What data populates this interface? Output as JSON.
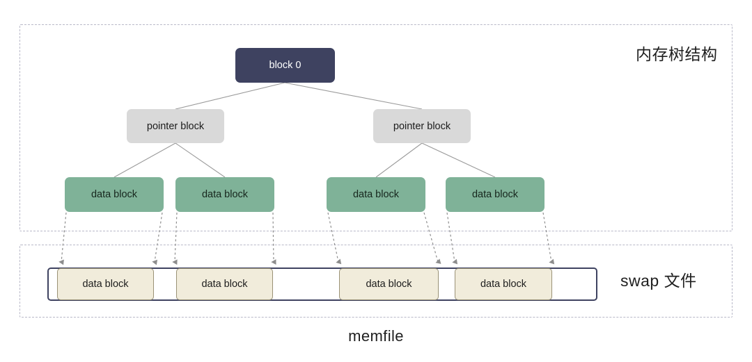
{
  "diagram": {
    "caption": "memfile",
    "panels": [
      {
        "key": "memtree",
        "label": "内存树结构"
      },
      {
        "key": "swap",
        "label": "swap 文件"
      }
    ],
    "tree": {
      "root": {
        "label": "block 0",
        "color": "#3e4260",
        "text_color": "#ffffff"
      },
      "pointer_blocks": [
        {
          "label": "pointer block",
          "color": "#d9d9d9"
        },
        {
          "label": "pointer block",
          "color": "#d9d9d9"
        }
      ],
      "data_blocks": [
        {
          "label": "data block",
          "color": "#7fb298"
        },
        {
          "label": "data block",
          "color": "#7fb298"
        },
        {
          "label": "data block",
          "color": "#7fb298"
        },
        {
          "label": "data block",
          "color": "#7fb298"
        }
      ]
    },
    "swap_file": {
      "border_color": "#3e4260",
      "slot_color": "#f1ecdb",
      "slots": [
        {
          "label": "data block"
        },
        {
          "label": "data block"
        },
        {
          "label": "data block"
        },
        {
          "label": "data block"
        }
      ]
    },
    "connector_color": "#9a9a9a",
    "arrow_color": "#8d8d8d",
    "panel_border_color": "#b8b8c8"
  }
}
